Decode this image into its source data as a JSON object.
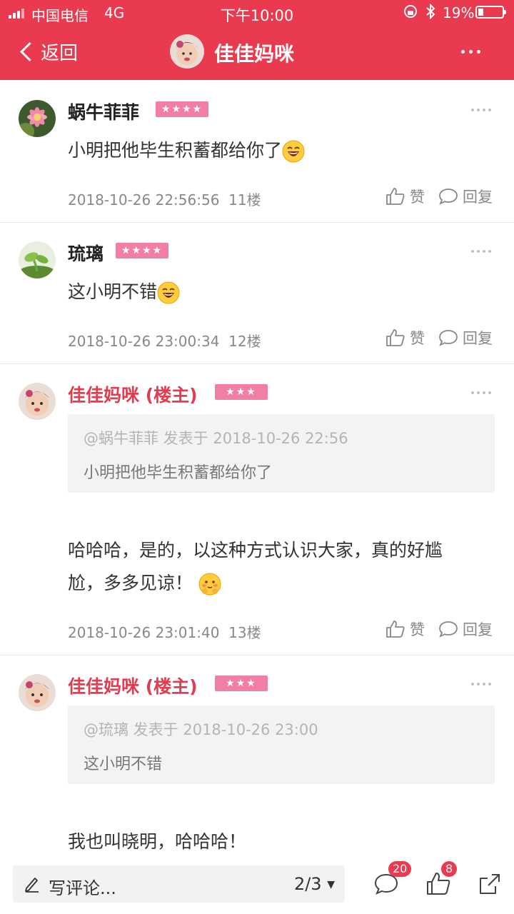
{
  "status_bar": {
    "carrier": "中国电信",
    "network": "4G",
    "time": "下午10:00",
    "battery_percent": "19%",
    "bluetooth_icon": "bluetooth-icon",
    "rotation_lock_icon": "rotation-lock-icon"
  },
  "header": {
    "back_label": "返回",
    "title": "佳佳妈咪",
    "more_icon": "more-dots-icon"
  },
  "colors": {
    "brand": "#ea3a4f",
    "op_name": "#e23c4f",
    "level_badge": "#f17fa3",
    "meta_text": "#888888"
  },
  "posts": [
    {
      "username": "蜗牛菲菲",
      "stars": "★★★★",
      "text": "小明把他毕生积蓄都给你了",
      "emoji": "laughing-face-emoji",
      "timestamp": "2018-10-26 22:56:56",
      "floor": "11楼",
      "like_label": "赞",
      "reply_label": "回复"
    },
    {
      "username": "琉璃",
      "stars": "★★★★",
      "text": "这小明不错",
      "emoji": "laughing-face-emoji",
      "timestamp": "2018-10-26 23:00:34",
      "floor": "12楼",
      "like_label": "赞",
      "reply_label": "回复"
    },
    {
      "username": "佳佳妈咪 (楼主)",
      "stars": "★★★",
      "quote_header": "@蜗牛菲菲 发表于 2018-10-26 22:56",
      "quote_text": "小明把他毕生积蓄都给你了",
      "text_line1": "哈哈哈，是的，以这种方式认识大家，真的好尴",
      "text_line2": "尬，多多见谅！",
      "emoji": "shy-face-emoji",
      "timestamp": "2018-10-26 23:01:40",
      "floor": "13楼",
      "like_label": "赞",
      "reply_label": "回复"
    },
    {
      "username": "佳佳妈咪 (楼主)",
      "stars": "★★★",
      "quote_header": "@琉璃 发表于 2018-10-26 23:00",
      "quote_text": "这小明不错",
      "text": "我也叫晓明，哈哈哈！"
    }
  ],
  "bottom_bar": {
    "compose_placeholder": "写评论...",
    "pager": "2/3",
    "comment_count": "20",
    "like_count": "8"
  }
}
